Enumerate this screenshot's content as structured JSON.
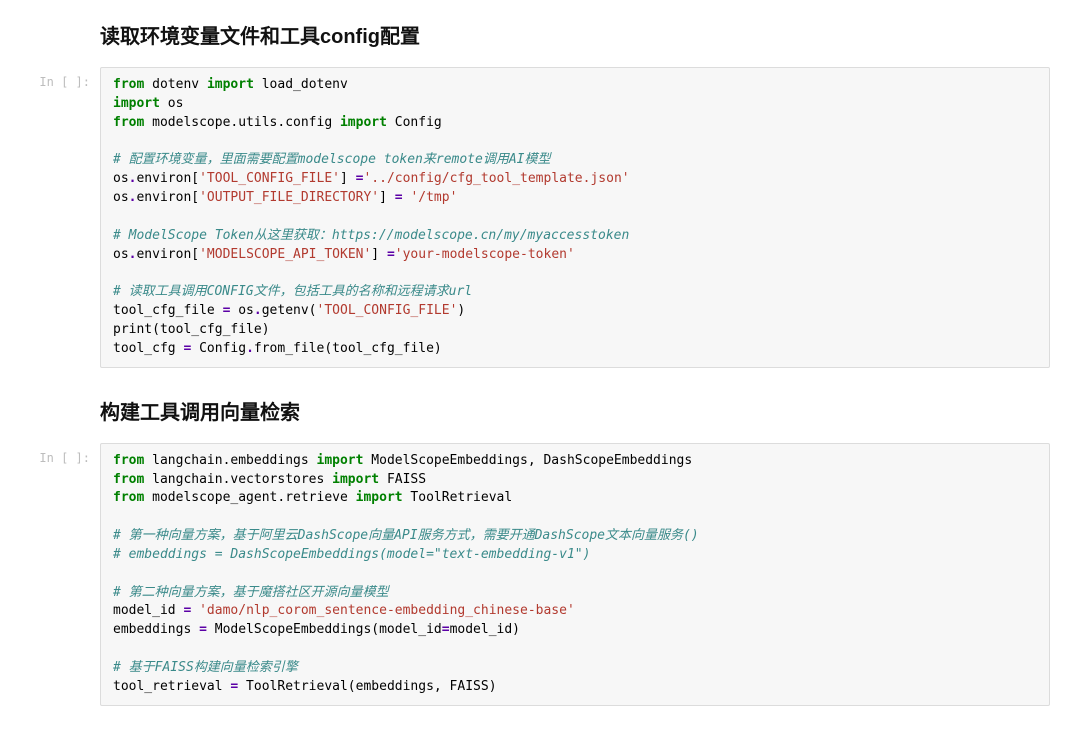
{
  "headings": {
    "h1": "读取环境变量文件和工具config配置",
    "h2": "构建工具调用向量检索"
  },
  "prompt_label": "In [ ]:",
  "cell1": {
    "l1": {
      "a": "from",
      "b": " dotenv ",
      "c": "import",
      "d": " load_dotenv"
    },
    "l2": {
      "a": "import",
      "b": " os"
    },
    "l3": {
      "a": "from",
      "b": " modelscope.utils.config ",
      "c": "import",
      "d": " Config"
    },
    "l5": "# 配置环境变量，里面需要配置modelscope token来remote调用AI模型",
    "l6": {
      "a": "os",
      "b": ".",
      "c": "environ[",
      "d": "'TOOL_CONFIG_FILE'",
      "e": "] ",
      "f": "=",
      "g": "'../config/cfg_tool_template.json'"
    },
    "l7": {
      "a": "os",
      "b": ".",
      "c": "environ[",
      "d": "'OUTPUT_FILE_DIRECTORY'",
      "e": "] ",
      "f": "=",
      "g": " ",
      "h": "'/tmp'"
    },
    "l9": "# ModelScope Token从这里获取：https://modelscope.cn/my/myaccesstoken",
    "l10": {
      "a": "os",
      "b": ".",
      "c": "environ[",
      "d": "'MODELSCOPE_API_TOKEN'",
      "e": "] ",
      "f": "=",
      "g": "'your-modelscope-token'"
    },
    "l12": "# 读取工具调用CONFIG文件，包括工具的名称和远程请求url",
    "l13": {
      "a": "tool_cfg_file ",
      "b": "=",
      "c": " os",
      "d": ".",
      "e": "getenv(",
      "f": "'TOOL_CONFIG_FILE'",
      "g": ")"
    },
    "l14": {
      "a": "print(tool_cfg_file)"
    },
    "l15": {
      "a": "tool_cfg ",
      "b": "=",
      "c": " Config",
      "d": ".",
      "e": "from_file(tool_cfg_file)"
    }
  },
  "cell2": {
    "l1": {
      "a": "from",
      "b": " langchain.embeddings ",
      "c": "import",
      "d": " ModelScopeEmbeddings, DashScopeEmbeddings"
    },
    "l2": {
      "a": "from",
      "b": " langchain.vectorstores ",
      "c": "import",
      "d": " FAISS"
    },
    "l3": {
      "a": "from",
      "b": " modelscope_agent.retrieve ",
      "c": "import",
      "d": " ToolRetrieval"
    },
    "l5": "# 第一种向量方案，基于阿里云DashScope向量API服务方式，需要开通DashScope文本向量服务()",
    "l6": "# embeddings = DashScopeEmbeddings(model=\"text-embedding-v1\")",
    "l8": "# 第二种向量方案，基于魔搭社区开源向量模型",
    "l9": {
      "a": "model_id ",
      "b": "=",
      "c": " ",
      "d": "'damo/nlp_corom_sentence-embedding_chinese-base'"
    },
    "l10": {
      "a": "embeddings ",
      "b": "=",
      "c": " ModelScopeEmbeddings(model_id",
      "d": "=",
      "e": "model_id)"
    },
    "l12": "# 基于FAISS构建向量检索引擎",
    "l13": {
      "a": "tool_retrieval ",
      "b": "=",
      "c": " ToolRetrieval(embeddings, FAISS)"
    }
  }
}
